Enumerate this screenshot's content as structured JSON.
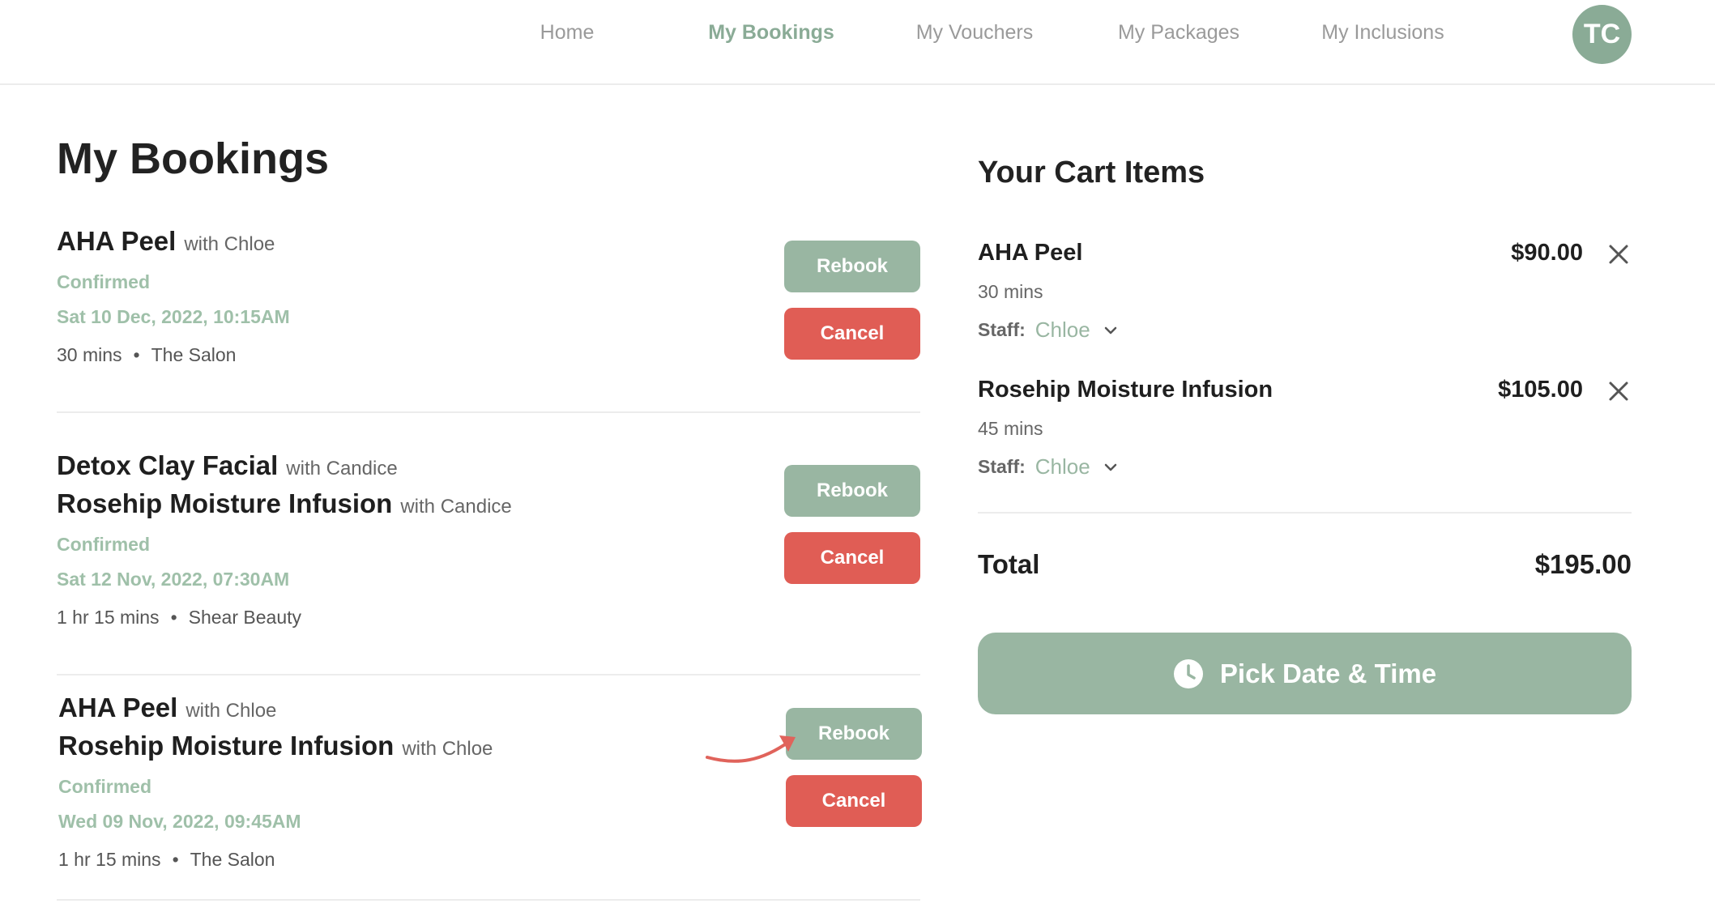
{
  "nav": {
    "items": [
      {
        "label": "Home"
      },
      {
        "label": "My Bookings"
      },
      {
        "label": "My Vouchers"
      },
      {
        "label": "My Packages"
      },
      {
        "label": "My Inclusions"
      }
    ],
    "active": "My Bookings",
    "avatar_initials": "TC"
  },
  "bookings": {
    "title": "My Bookings",
    "rebook_label": "Rebook",
    "cancel_label": "Cancel",
    "items": [
      {
        "services": [
          {
            "name": "AHA Peel",
            "with": "with Chloe"
          }
        ],
        "status": "Confirmed",
        "datetime": "Sat 10 Dec, 2022, 10:15AM",
        "duration": "30 mins",
        "location": "The Salon"
      },
      {
        "services": [
          {
            "name": "Detox Clay Facial",
            "with": "with Candice"
          },
          {
            "name": "Rosehip Moisture Infusion",
            "with": "with Candice"
          }
        ],
        "status": "Confirmed",
        "datetime": "Sat 12 Nov, 2022, 07:30AM",
        "duration": "1 hr 15 mins",
        "location": "Shear Beauty"
      },
      {
        "services": [
          {
            "name": "AHA Peel",
            "with": "with Chloe"
          },
          {
            "name": "Rosehip Moisture Infusion",
            "with": "with Chloe"
          }
        ],
        "status": "Confirmed",
        "datetime": "Wed 09 Nov, 2022, 09:45AM",
        "duration": "1 hr 15 mins",
        "location": "The Salon"
      }
    ]
  },
  "cart": {
    "title": "Your Cart Items",
    "staff_label": "Staff:",
    "items": [
      {
        "name": "AHA Peel",
        "price": "$90.00",
        "duration": "30 mins",
        "staff": "Chloe"
      },
      {
        "name": "Rosehip Moisture Infusion",
        "price": "$105.00",
        "duration": "45 mins",
        "staff": "Chloe"
      }
    ],
    "total_label": "Total",
    "total_value": "$195.00",
    "pick_label": "Pick Date & Time"
  },
  "colors": {
    "accent": "#8aab96",
    "button_green": "#99b6a2",
    "button_red": "#e05d55",
    "annotation_arrow": "#e0635b"
  },
  "icons": {
    "remove": "close-icon",
    "staff_dropdown": "chevron-down-icon",
    "pick": "clock-icon"
  }
}
